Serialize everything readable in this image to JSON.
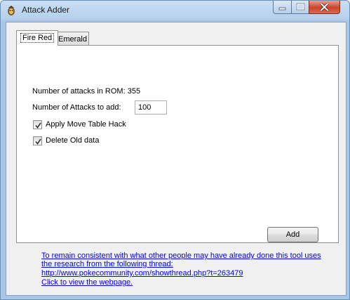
{
  "window": {
    "title": "Attack Adder",
    "accent_color": "#a9c6e6",
    "icons": [
      "app-icon",
      "minimize-icon",
      "maximize-icon",
      "close-icon"
    ]
  },
  "tabs": [
    {
      "label": "Fire Red",
      "selected": true
    },
    {
      "label": "Emerald",
      "selected": false
    }
  ],
  "form": {
    "attacks_in_rom_label": "Number of attacks in ROM: 355",
    "attacks_to_add_label": "Number of Attacks to add:",
    "attacks_to_add_value": "100",
    "move_table_hack_label": "Apply Move Table Hack",
    "move_table_hack_checked": true,
    "delete_old_data_label": "Delete Old data",
    "delete_old_data_checked": true,
    "add_button_label": "Add"
  },
  "footer": {
    "line1": "To remain consistent with what other people may have already done this tool uses",
    "line2": "the research from the following thread:",
    "url": "http://www.pokecommunity.com/showthread.php?t=263479",
    "webpage_link": "Click to view the webpage.",
    "link_color": "#0000ff"
  }
}
